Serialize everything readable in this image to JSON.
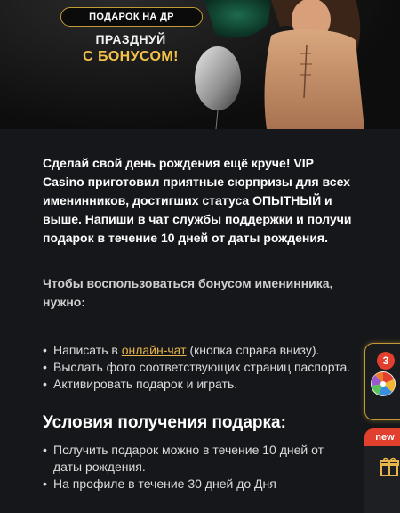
{
  "banner": {
    "badge": "ПОДАРОК НА ДР",
    "line1": "ПРАЗДНУЙ",
    "line2": "С БОНУСОМ!"
  },
  "intro": "Сделай свой день рождения ещё круче! VIP Casino приготовил приятные сюрпризы для всех именинников, достигших статуса ОПЫТНЫЙ и выше. Напиши в чат службы поддержки и получи подарок в течение 10 дней от даты рождения.",
  "subheading": "Чтобы воспользоваться бонусом именинника, нужно:",
  "steps": {
    "item1_before": "Написать в ",
    "item1_link": "онлайн-чат",
    "item1_after": " (кнопка справа внизу).",
    "item2": "Выслать фото соответствующих страниц паспорта.",
    "item3": "Активировать подарок и играть."
  },
  "conditions": {
    "title": "Условия получения подарка:",
    "items": [
      "Получить подарок можно в течение 10 дней от даты рождения.",
      "На профиле в течение 30 дней до Дня"
    ]
  },
  "widgets": {
    "wheel_count": "3",
    "new_label": "new"
  },
  "colors": {
    "accent_gold": "#c49a36",
    "link": "#e8b54a",
    "badge_red": "#e2402e",
    "background": "#16171a"
  }
}
